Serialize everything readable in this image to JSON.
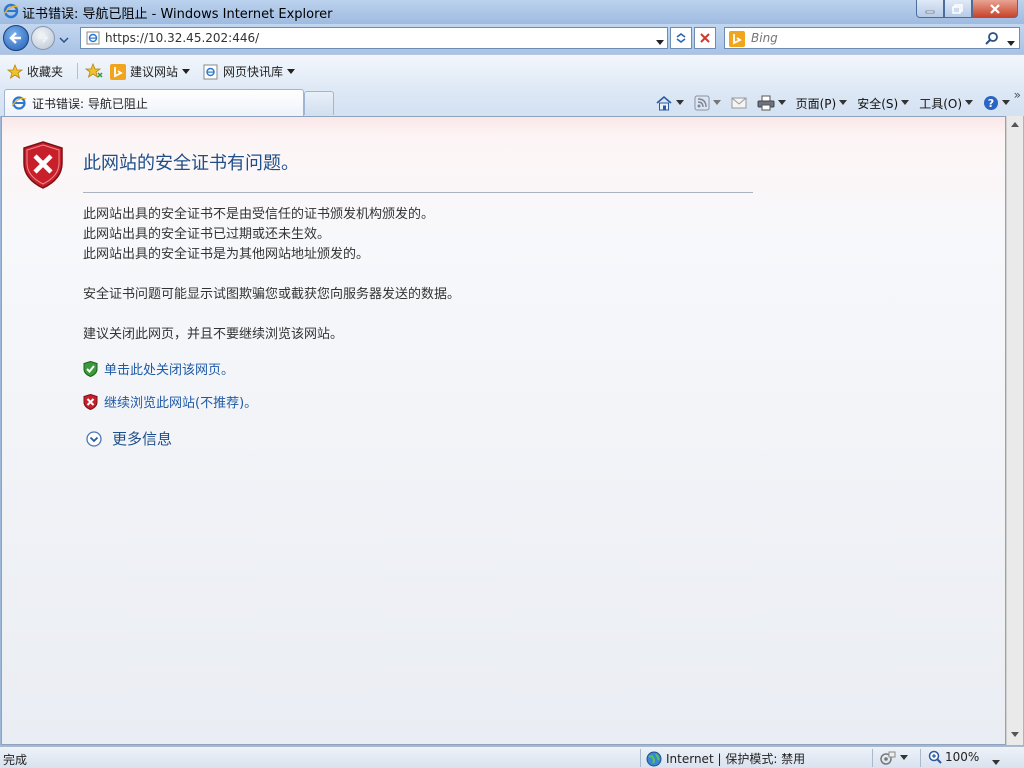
{
  "window": {
    "title": "证书错误: 导航已阻止 - Windows Internet Explorer"
  },
  "address": {
    "url": "https://10.32.45.202:446/"
  },
  "search": {
    "placeholder": "Bing"
  },
  "favorites_bar": {
    "favorites_label": "收藏夹",
    "suggested_sites": "建议网站",
    "web_slice_gallery": "网页快讯库"
  },
  "tab": {
    "label": "证书错误: 导航已阻止"
  },
  "command_bar": {
    "page": "页面(P)",
    "safety": "安全(S)",
    "tools": "工具(O)",
    "more": "»"
  },
  "content": {
    "heading": "此网站的安全证书有问题。",
    "reasons": [
      "此网站出具的安全证书不是由受信任的证书颁发机构颁发的。",
      "此网站出具的安全证书已过期或还未生效。",
      "此网站出具的安全证书是为其他网站地址颁发的。"
    ],
    "warning": "安全证书问题可能显示试图欺骗您或截获您向服务器发送的数据。",
    "recommendation": "建议关闭此网页，并且不要继续浏览该网站。",
    "close_link": "单击此处关闭该网页。",
    "continue_link": "继续浏览此网站(不推荐)。",
    "more_info": "更多信息"
  },
  "status_bar": {
    "status": "完成",
    "zone": "Internet | 保护模式: 禁用",
    "zoom": "100%"
  },
  "colors": {
    "heading": "#1f4f8a",
    "link": "#1f5aa6",
    "shield_red": "#c8202a",
    "shield_green": "#3c9a3c"
  },
  "icons": [
    "ie-logo-icon",
    "back-icon",
    "forward-icon",
    "refresh-icon",
    "stop-icon",
    "bing-icon",
    "search-icon",
    "star-icon",
    "home-icon",
    "rss-icon",
    "mail-icon",
    "print-icon",
    "help-icon",
    "error-shield-icon",
    "globe-icon",
    "zoom-icon"
  ]
}
